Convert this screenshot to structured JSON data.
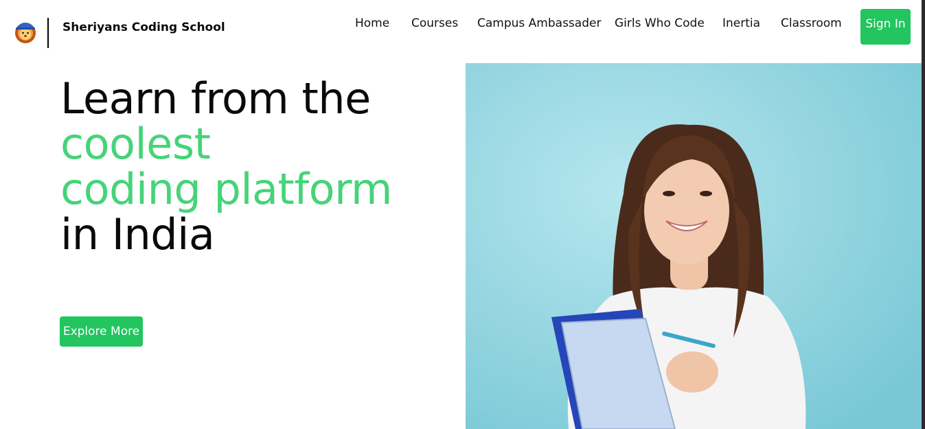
{
  "header": {
    "brand": "Sheriyans Coding School",
    "logo_icon": "lion-mascot-icon",
    "nav": [
      {
        "label": "Home"
      },
      {
        "label": "Courses"
      },
      {
        "label": "Campus Ambassader"
      },
      {
        "label": "Girls Who Code"
      },
      {
        "label": "Inertia"
      },
      {
        "label": "Classroom"
      }
    ],
    "sign_in": "Sign In"
  },
  "hero": {
    "line1": "Learn from the",
    "line2": "coolest",
    "line3": "coding platform",
    "line4": "in India",
    "cta": "Explore More",
    "image": "smiling-student-holding-notebooks"
  },
  "colors": {
    "accent": "#22c55e",
    "headline_green": "#45d478",
    "image_background": "#8fd3df"
  }
}
